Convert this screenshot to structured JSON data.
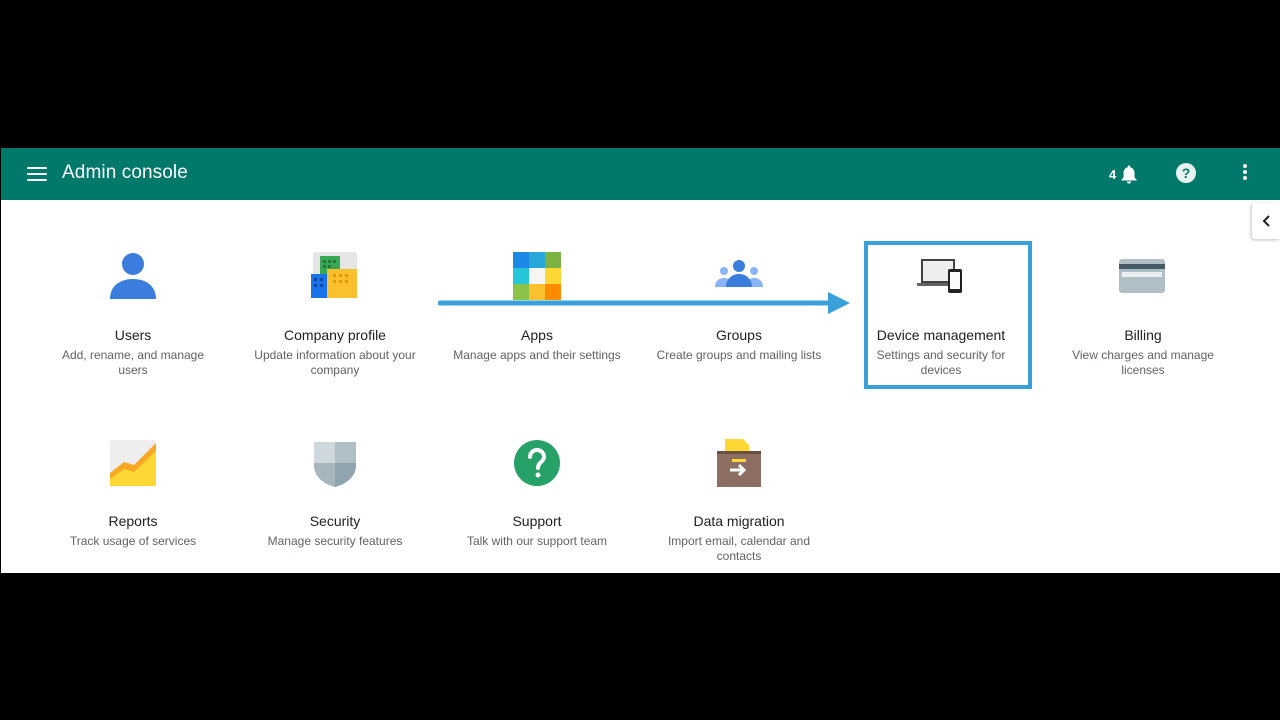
{
  "header": {
    "title": "Admin console",
    "notification_count": "4",
    "menu_icon": "hamburger-menu-icon",
    "notification_icon": "bell-icon",
    "help_icon": "help-circle-icon",
    "more_icon": "more-vert-icon",
    "help_glyph": "?"
  },
  "side_panel": {
    "toggle_icon": "chevron-left-icon"
  },
  "tiles": [
    {
      "name": "Users",
      "desc": "Add, rename, and manage users",
      "icon": "user-icon"
    },
    {
      "name": "Company profile",
      "desc": "Update information about your company",
      "icon": "buildings-icon"
    },
    {
      "name": "Apps",
      "desc": "Manage apps and their settings",
      "icon": "apps-grid-icon"
    },
    {
      "name": "Groups",
      "desc": "Create groups and mailing lists",
      "icon": "groups-icon"
    },
    {
      "name": "Device management",
      "desc": "Settings and security for devices",
      "icon": "devices-icon"
    },
    {
      "name": "Billing",
      "desc": "View charges and manage licenses",
      "icon": "credit-card-icon"
    },
    {
      "name": "Reports",
      "desc": "Track usage of services",
      "icon": "chart-icon"
    },
    {
      "name": "Security",
      "desc": "Manage security features",
      "icon": "shield-icon"
    },
    {
      "name": "Support",
      "desc": "Talk with our support team",
      "icon": "help-icon"
    },
    {
      "name": "Data migration",
      "desc": "Import email, calendar and contacts",
      "icon": "migration-box-icon"
    }
  ],
  "annotation": {
    "highlighted_tile": "Device management",
    "arrow_color": "#3aa0da"
  },
  "colors": {
    "header_bg": "#00796b",
    "accent_blue": "#3aa0da"
  }
}
